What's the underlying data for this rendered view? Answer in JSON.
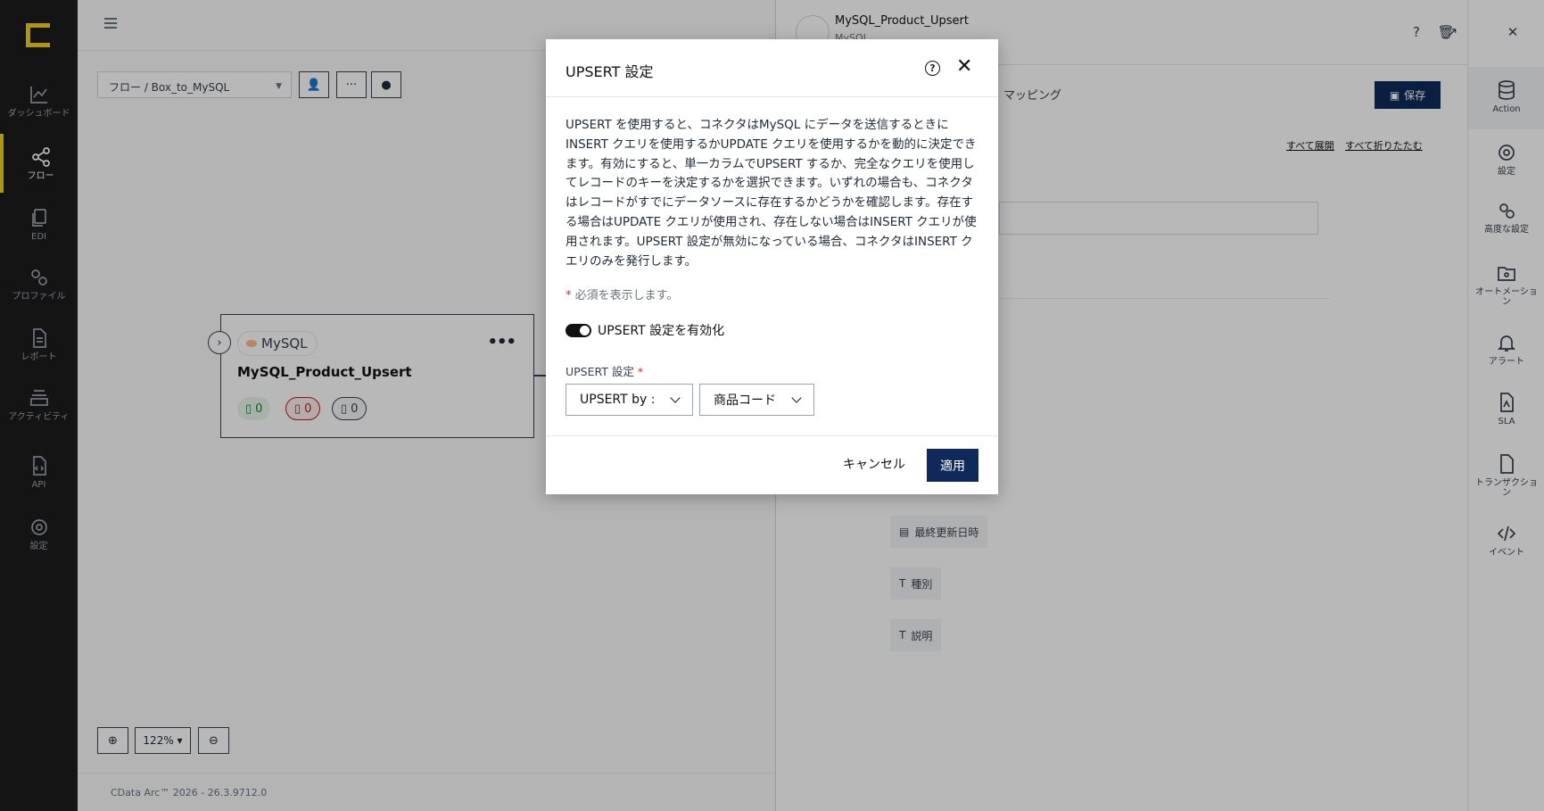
{
  "sidebar": {
    "items": [
      {
        "label": "ダッシュボード",
        "icon": "chart-line-icon"
      },
      {
        "label": "フロー",
        "icon": "flow-share-icon"
      },
      {
        "label": "EDI",
        "icon": "documents-icon"
      },
      {
        "label": "プロファイル",
        "icon": "gears-icon"
      },
      {
        "label": "レポート",
        "icon": "report-icon"
      },
      {
        "label": "アクティビティ",
        "icon": "layers-icon"
      },
      {
        "label": "API",
        "icon": "api-document-icon"
      },
      {
        "label": "設定",
        "icon": "settings-gear-icon"
      }
    ],
    "active_index": 1,
    "accent": "#f5d212"
  },
  "canvas": {
    "breadcrumb": "フロー /   Box_to_MySQL",
    "node": {
      "badge": "MySQL",
      "title": "MySQL_Product_Upsert",
      "counts": [
        "0",
        "0",
        "0"
      ]
    },
    "zoom": "122%",
    "footer": "CData Arc™ 2026 - 26.3.9712.0"
  },
  "panel": {
    "title": "MySQL_Product_Upsert",
    "subtitle": "MySQL",
    "mapping_tab": "マッピング",
    "save_label": "保存",
    "expand_all": "すべて展開",
    "collapse_all": "すべて折りたたむ",
    "fields": [
      "最終更新日時",
      "種別",
      "説明"
    ]
  },
  "rail": {
    "items": [
      {
        "label": "Action",
        "icon": "database-icon"
      },
      {
        "label": "設定",
        "icon": "gear-icon"
      },
      {
        "label": "高度な設定",
        "icon": "advanced-gears-icon"
      },
      {
        "label": "オートメーション",
        "icon": "automation-folder-icon"
      },
      {
        "label": "アラート",
        "icon": "bell-icon"
      },
      {
        "label": "SLA",
        "icon": "sla-document-icon"
      },
      {
        "label": "トランザクション",
        "icon": "transaction-document-icon"
      },
      {
        "label": "イベント",
        "icon": "code-icon"
      }
    ]
  },
  "modal": {
    "title": "UPSERT 設定",
    "description": "UPSERT を使用すると、コネクタはMySQL にデータを送信するときにINSERT クエリを使用するかUPDATE クエリを使用するかを動的に決定できます。有効にすると、単一カラムでUPSERT するか、完全なクエリを使用してレコードのキーを決定するかを選択できます。いずれの場合も、コネクタはレコードがすでにデータソースに存在するかどうかを確認します。存在する場合はUPDATE クエリが使用され、存在しない場合はINSERT クエリが使用されます。UPSERT 設定が無効になっている場合、コネクタはINSERT クエリのみを発行します。",
    "required_note": "必須を表示します。",
    "toggle_label": "UPSERT 設定を有効化",
    "toggle_on": true,
    "field_label": "UPSERT 設定",
    "select_mode": "UPSERT by :",
    "select_column": "商品コード",
    "cancel_label": "キャンセル",
    "apply_label": "適用",
    "primary_color": "#0f2a5a"
  }
}
